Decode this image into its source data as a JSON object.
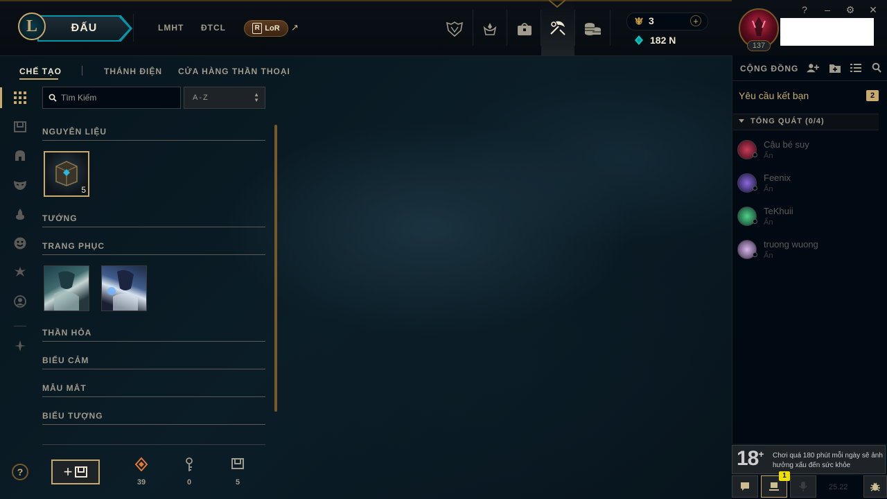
{
  "window": {
    "controls": {
      "help": "?",
      "minimize": "–",
      "settings": "⚙",
      "close": "✕"
    }
  },
  "header": {
    "logo_letter": "L",
    "play_label": "ĐẤU",
    "nav_links": [
      "LMHT",
      "ĐTCL"
    ],
    "lor_badge": {
      "letter": "R",
      "label": "LoR"
    },
    "external_arrow": "↗",
    "nav_icons": [
      "worlds-icon",
      "ranked-icon",
      "store-bag-icon",
      "loot-crafting-icon",
      "store-coins-icon"
    ],
    "active_nav_icon": "loot-crafting-icon",
    "currency": {
      "orange_essence": "3",
      "blue_essence": "182 N",
      "add": "+"
    }
  },
  "profile": {
    "level": "137"
  },
  "subnav": {
    "tabs": [
      "CHẾ TẠO",
      "THÁNH ĐIỆN",
      "CỬA HÀNG THẦN THOẠI"
    ],
    "active": "CHẾ TẠO"
  },
  "sidebar": {
    "icons": [
      "all-grid-icon",
      "chest-icon",
      "champion-helmet-icon",
      "skin-mask-icon",
      "ward-flame-icon",
      "emote-face-icon",
      "icon-tree-icon",
      "profile-icon",
      "eternals-icon"
    ],
    "active": "all-grid-icon",
    "help": "?"
  },
  "filters": {
    "search_placeholder": "Tìm Kiếm",
    "sort_value": "A-Z"
  },
  "loot_sections": [
    {
      "title": "NGUYÊN LIỆU"
    },
    {
      "title": "TƯỚNG"
    },
    {
      "title": "TRANG PHỤC"
    },
    {
      "title": "THẦN HỎA"
    },
    {
      "title": "BIỂU CẢM"
    },
    {
      "title": "MẪU MẮT"
    },
    {
      "title": "BIỂU TƯỢNG"
    }
  ],
  "loot_items": {
    "materials": [
      {
        "icon": "hextech-chest-icon",
        "count": "5"
      }
    ],
    "skins": [
      {
        "icon": "skin-1"
      },
      {
        "icon": "skin-2"
      }
    ]
  },
  "footer": {
    "craft_plus": "+",
    "stats": [
      {
        "icon": "orange-essence-icon",
        "value": "39"
      },
      {
        "icon": "key-icon",
        "value": "0"
      },
      {
        "icon": "chest-small-icon",
        "value": "5"
      }
    ]
  },
  "social": {
    "title": "CỘNG ĐỒNG",
    "friend_requests_label": "Yêu cầu kết bạn",
    "friend_requests_count": "2",
    "group_label": "TỔNG QUÁT (0/4)",
    "friends": [
      {
        "name": "Cậu bé suy",
        "status": "Ẩn"
      },
      {
        "name": "Feenix",
        "status": "Ẩn"
      },
      {
        "name": "TeKhuii",
        "status": "Ẩn"
      },
      {
        "name": "truong wuong",
        "status": "Ẩn"
      }
    ]
  },
  "age_notice": {
    "rating": "18",
    "plus": "+",
    "text": "Chơi quá 180 phút mỗi ngày sẽ ảnh hưởng xấu đến sức khỏe"
  },
  "bottom_bar": {
    "notification_count": "1",
    "version": "25.22"
  },
  "colors": {
    "gold": "#c8aa6e",
    "gold_dark": "#785a28",
    "text": "#a09b8c",
    "text_bright": "#f0e6d2",
    "blue_accent": "#0596aa",
    "background": "#010a13"
  }
}
